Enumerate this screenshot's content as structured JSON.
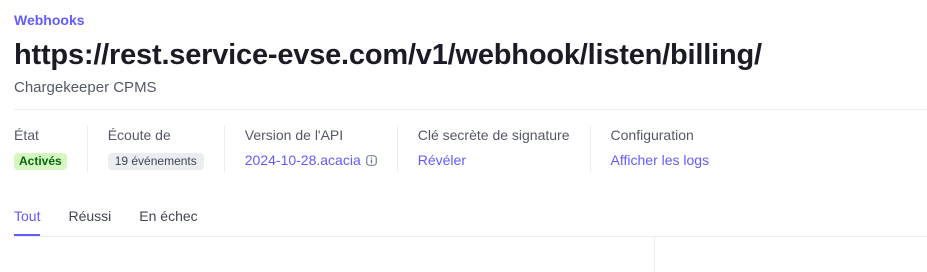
{
  "breadcrumb": "Webhooks",
  "title": "https://rest.service-evse.com/v1/webhook/listen/billing/",
  "subtitle": "Chargekeeper CPMS",
  "meta": {
    "status": {
      "label": "État",
      "value": "Activés"
    },
    "listening": {
      "label": "Écoute de",
      "value": "19 événements"
    },
    "api_version": {
      "label": "Version de l'API",
      "value": "2024-10-28.acacia",
      "icon": "info-icon"
    },
    "signing_secret": {
      "label": "Clé secrète de signature",
      "value": "Révéler"
    },
    "configuration": {
      "label": "Configuration",
      "value": "Afficher les logs"
    }
  },
  "tabs": [
    {
      "label": "Tout",
      "active": true
    },
    {
      "label": "Réussi",
      "active": false
    },
    {
      "label": "En échec",
      "active": false
    }
  ],
  "colors": {
    "accent": "#635bff",
    "success_bg": "#d7f7c2",
    "success_text": "#05690d"
  }
}
